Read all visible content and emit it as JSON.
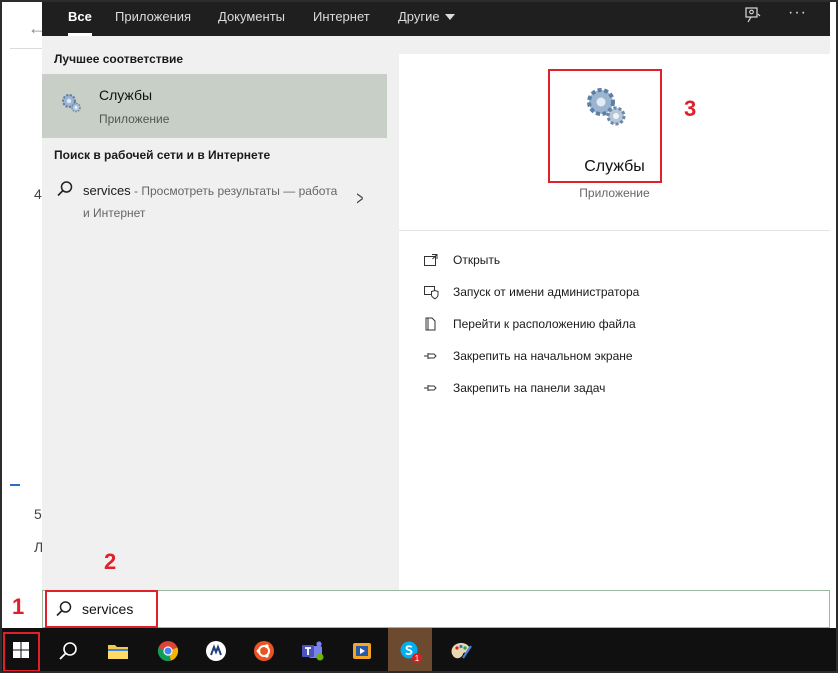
{
  "background": {
    "back_arrow": "←",
    "fragment_1": "4",
    "fragment_2": "5",
    "fragment_3": "Л"
  },
  "tabs": [
    {
      "label": "Все",
      "active": true
    },
    {
      "label": "Приложения"
    },
    {
      "label": "Документы"
    },
    {
      "label": "Интернет"
    },
    {
      "label": "Другие"
    }
  ],
  "top_icons": {
    "feedback": "feedback-icon",
    "more": "···"
  },
  "left": {
    "best_match_header": "Лучшее соответствие",
    "best_match": {
      "title": "Службы",
      "subtitle": "Приложение"
    },
    "web_header": "Поиск в рабочей сети и в Интернете",
    "web_result": {
      "query": "services",
      "description": " - Просмотреть результаты — работа и Интернет"
    }
  },
  "preview": {
    "title": "Службы",
    "subtitle": "Приложение",
    "actions": [
      {
        "label": "Открыть",
        "icon": "open-icon"
      },
      {
        "label": "Запуск от имени администратора",
        "icon": "shield-icon"
      },
      {
        "label": "Перейти к расположению файла",
        "icon": "file-location-icon"
      },
      {
        "label": "Закрепить на начальном экране",
        "icon": "pin-icon"
      },
      {
        "label": "Закрепить на панели задач",
        "icon": "pin-icon"
      }
    ]
  },
  "search": {
    "value": "services"
  },
  "taskbar": {
    "items": [
      "start-icon",
      "search-icon",
      "file-explorer-icon",
      "chrome-icon",
      "app-icon",
      "ubuntu-icon",
      "teams-icon",
      "media-player-icon",
      "skype-icon",
      "paint-icon"
    ],
    "skype_badge": "1"
  },
  "annotations": {
    "one": "1",
    "two": "2",
    "three": "3"
  },
  "colors": {
    "annotation": "#e0202a",
    "selected": "#c8cfc6",
    "tab_bar": "#1f1f1f",
    "taskbar": "#101010"
  }
}
